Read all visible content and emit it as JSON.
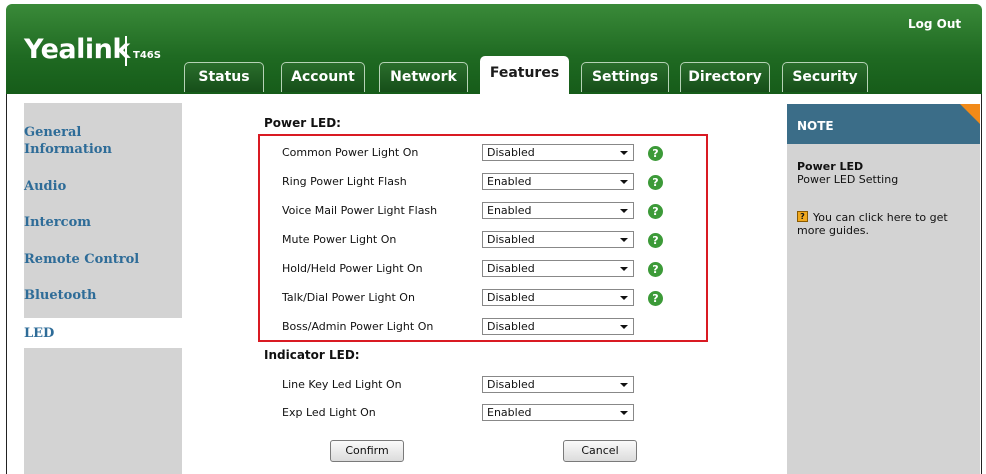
{
  "header": {
    "brand": "Yealink",
    "model": "T46S",
    "logout": "Log Out",
    "tabs": [
      "Status",
      "Account",
      "Network",
      "Features",
      "Settings",
      "Directory",
      "Security"
    ],
    "active_tab": "Features"
  },
  "sidebar": {
    "items": [
      "General\nInformation",
      "Audio",
      "Intercom",
      "Remote Control",
      "Bluetooth",
      "LED"
    ],
    "active_item": "LED"
  },
  "form": {
    "power_section": "Power LED:",
    "indicator_section": "Indicator LED:",
    "power_fields": [
      {
        "label": "Common Power Light On",
        "value": "Disabled"
      },
      {
        "label": "Ring Power Light Flash",
        "value": "Enabled"
      },
      {
        "label": "Voice Mail Power Light Flash",
        "value": "Enabled"
      },
      {
        "label": "Mute Power Light On",
        "value": "Disabled"
      },
      {
        "label": "Hold/Held Power Light On",
        "value": "Disabled"
      },
      {
        "label": "Talk/Dial Power Light On",
        "value": "Disabled"
      },
      {
        "label": "Boss/Admin Power Light On",
        "value": "Disabled"
      }
    ],
    "indicator_fields": [
      {
        "label": "Line Key Led Light On",
        "value": "Disabled"
      },
      {
        "label": "Exp Led Light On",
        "value": "Enabled"
      }
    ],
    "help_glyph": "?",
    "confirm": "Confirm",
    "cancel": "Cancel"
  },
  "note": {
    "title": "NOTE",
    "heading": "Power LED",
    "subheading": "Power LED Setting",
    "guide_text_1": "You can click here to get",
    "guide_text_2": "more guides.",
    "guide_icon_glyph": "?"
  },
  "colors": {
    "header_green": "#1f6a22",
    "nav_blue": "#2e6c98",
    "highlight_red": "#d91a23",
    "note_blue": "#3b6d88",
    "note_orange": "#f28a18",
    "help_green": "#3c9a38"
  }
}
